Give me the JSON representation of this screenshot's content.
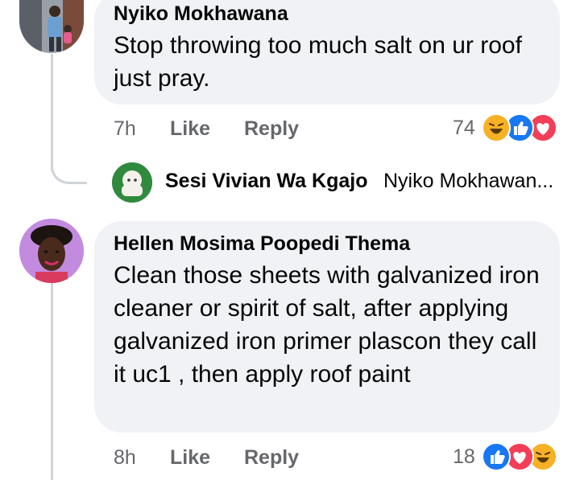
{
  "comments": [
    {
      "author": "Nyiko Mokhawana",
      "text": "Stop throwing too much salt on ur roof just pray.",
      "time": "7h",
      "like_label": "Like",
      "reply_label": "Reply",
      "reaction_count": "74",
      "reactions": [
        "haha-icon",
        "like-icon",
        "love-icon"
      ]
    },
    {
      "author": "Hellen Mosima Poopedi Thema",
      "text": "Clean those sheets with galvanized iron cleaner or spirit of salt, after applying galvanized iron primer plascon they call it uc1 , then apply roof paint",
      "time": "8h",
      "like_label": "Like",
      "reply_label": "Reply",
      "reaction_count": "18",
      "reactions": [
        "like-icon",
        "love-icon",
        "haha-icon"
      ]
    }
  ],
  "reply_preview": {
    "author": "Sesi Vivian Wa Kgajo",
    "snippet": "Nyiko Mokhawan..."
  },
  "colors": {
    "bubble": "#f0f2f5",
    "like_blue": "#1877f2",
    "love_red": "#f33e58",
    "haha_yellow": "#f7b125",
    "secondary_text": "#65676b"
  }
}
